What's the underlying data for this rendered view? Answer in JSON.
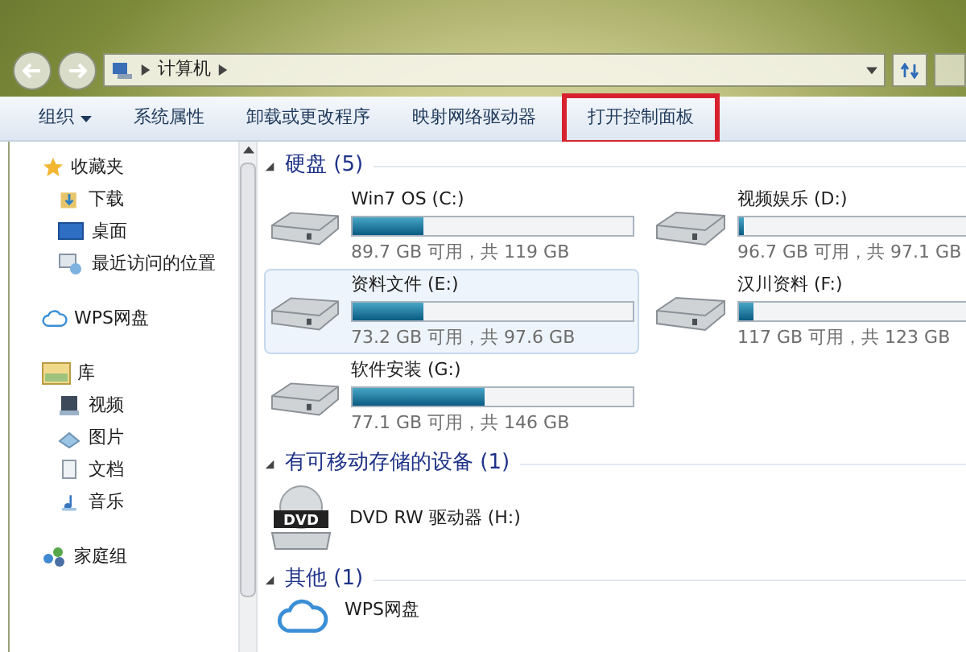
{
  "address_bar": {
    "path": [
      "计算机"
    ]
  },
  "toolbar": [
    {
      "label": "组织",
      "has_menu": true,
      "highlighted": false
    },
    {
      "label": "系统属性",
      "has_menu": false,
      "highlighted": false
    },
    {
      "label": "卸载或更改程序",
      "has_menu": false,
      "highlighted": false
    },
    {
      "label": "映射网络驱动器",
      "has_menu": false,
      "highlighted": false
    },
    {
      "label": "打开控制面板",
      "has_menu": false,
      "highlighted": true
    }
  ],
  "sidebar": {
    "groups": [
      {
        "label": "收藏夹",
        "kind": "star",
        "children": [
          {
            "label": "下载",
            "kind": "download"
          },
          {
            "label": "桌面",
            "kind": "desktop"
          },
          {
            "label": "最近访问的位置",
            "kind": "recent"
          }
        ]
      },
      {
        "label": "WPS网盘",
        "kind": "cloud"
      },
      {
        "label": "库",
        "kind": "library",
        "children": [
          {
            "label": "视频",
            "kind": "video"
          },
          {
            "label": "图片",
            "kind": "picture"
          },
          {
            "label": "文档",
            "kind": "document"
          },
          {
            "label": "音乐",
            "kind": "music"
          }
        ]
      },
      {
        "label": "家庭组",
        "kind": "homegroup"
      }
    ]
  },
  "sections": [
    {
      "title": "硬盘 (5)",
      "items": [
        {
          "kind": "disk",
          "name": "Win7 OS (C:)",
          "level": 0.25,
          "info": "89.7 GB 可用，共 119 GB",
          "selected": false
        },
        {
          "kind": "disk",
          "name": "视频娱乐 (D:)",
          "level": 0.004,
          "info": "96.7 GB 可用，共 97.1 GB",
          "selected": false
        },
        {
          "kind": "disk",
          "name": "资料文件 (E:)",
          "level": 0.25,
          "info": "73.2 GB 可用，共 97.6 GB",
          "selected": true
        },
        {
          "kind": "disk",
          "name": "汉川资料 (F:)",
          "level": 0.05,
          "info": "117 GB 可用，共 123 GB",
          "selected": false
        },
        {
          "kind": "disk",
          "name": "软件安装 (G:)",
          "level": 0.47,
          "info": "77.1 GB 可用，共 146 GB",
          "selected": false
        }
      ]
    },
    {
      "title": "有可移动存储的设备 (1)",
      "items": [
        {
          "kind": "dvd",
          "icon_label": "DVD",
          "name": "DVD RW 驱动器 (H:)",
          "selected": false
        }
      ]
    },
    {
      "title": "其他 (1)",
      "items": [
        {
          "kind": "cloud",
          "name": "WPS网盘",
          "selected": false
        }
      ]
    }
  ]
}
